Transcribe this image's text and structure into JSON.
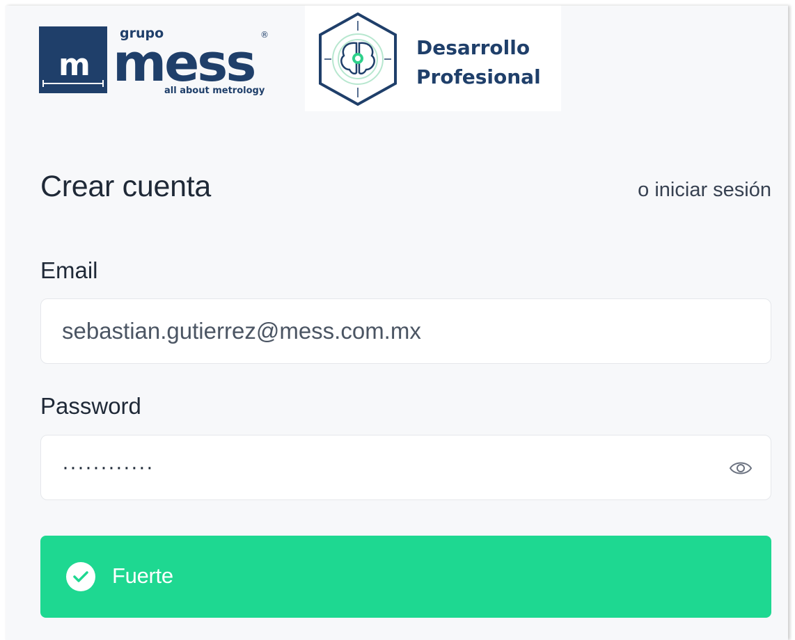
{
  "brand": {
    "mess_logo": {
      "small_top": "grupo",
      "word": "mess",
      "tagline": "all about metrology",
      "mark": "m",
      "registered": "®"
    },
    "dp_logo": {
      "line1": "Desarrollo",
      "line2": "Profesional"
    }
  },
  "header": {
    "title": "Crear cuenta",
    "signin_link": "o iniciar sesión"
  },
  "form": {
    "email": {
      "label": "Email",
      "value": "sebastian.gutierrez@mess.com.mx"
    },
    "password": {
      "label": "Password",
      "value": "············",
      "toggle_icon": "eye-icon"
    }
  },
  "strength": {
    "label": "Fuerte",
    "icon": "check-circle-icon",
    "color": "#1ed891"
  },
  "colors": {
    "brand_navy": "#1f3f6a",
    "accent_green": "#1ed891"
  }
}
